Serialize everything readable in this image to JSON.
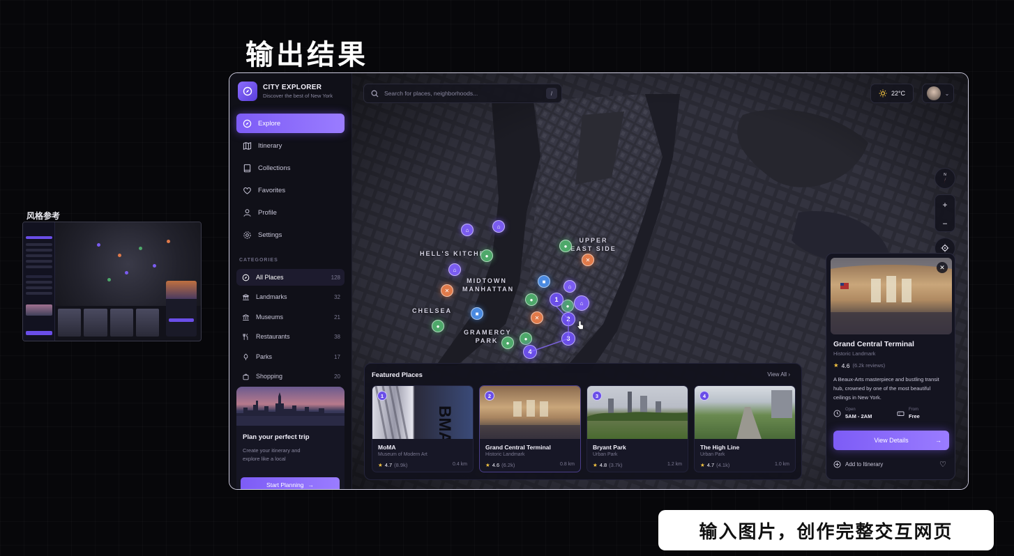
{
  "headline": "输出结果",
  "reference_label": "风格参考",
  "subtitle": "输入图片，创作完整交互网页",
  "brand": {
    "title": "CITY EXPLORER",
    "subtitle": "Discover the best of New York"
  },
  "nav": [
    {
      "label": "Explore",
      "icon": "compass-icon",
      "active": true
    },
    {
      "label": "Itinerary",
      "icon": "map-icon"
    },
    {
      "label": "Collections",
      "icon": "book-icon"
    },
    {
      "label": "Favorites",
      "icon": "heart-icon"
    },
    {
      "label": "Profile",
      "icon": "user-icon"
    },
    {
      "label": "Settings",
      "icon": "gear-icon"
    }
  ],
  "categories": {
    "header": "CATEGORIES",
    "items": [
      {
        "label": "All Places",
        "count": "128",
        "icon": "compass-icon",
        "active": true
      },
      {
        "label": "Landmarks",
        "count": "32",
        "icon": "landmark-icon"
      },
      {
        "label": "Museums",
        "count": "21",
        "icon": "museum-icon"
      },
      {
        "label": "Restaurants",
        "count": "38",
        "icon": "utensils-icon"
      },
      {
        "label": "Parks",
        "count": "17",
        "icon": "tree-icon"
      },
      {
        "label": "Shopping",
        "count": "20",
        "icon": "bag-icon"
      }
    ]
  },
  "promo": {
    "title": "Plan your perfect trip",
    "text": "Create your itinerary and explore like a local",
    "button": "Start Planning"
  },
  "search": {
    "placeholder": "Search for places, neighborhoods...",
    "shortcut": "/"
  },
  "weather": {
    "temp": "22°C",
    "icon": "sun-icon"
  },
  "map_controls": {
    "compass": "N",
    "zoom_in": "+",
    "zoom_out": "−"
  },
  "map_labels": [
    {
      "text": "HELL'S KITCHEN"
    },
    {
      "text": "MIDTOWN MANHATTAN"
    },
    {
      "text": "CHELSEA"
    },
    {
      "text": "GRAMERCY PARK"
    },
    {
      "text": "UPPER EAST SIDE"
    }
  ],
  "featured": {
    "title": "Featured Places",
    "view_all": "View All",
    "cards": [
      {
        "num": "1",
        "name": "MoMA",
        "type": "Museum of Modern Art",
        "rating": "4.7",
        "reviews": "(8.9k)",
        "distance": "0.4 km"
      },
      {
        "num": "2",
        "name": "Grand Central Terminal",
        "type": "Historic Landmark",
        "rating": "4.6",
        "reviews": "(6.2k)",
        "distance": "0.8 km"
      },
      {
        "num": "3",
        "name": "Bryant Park",
        "type": "Urban Park",
        "rating": "4.8",
        "reviews": "(3.7k)",
        "distance": "1.2 km"
      },
      {
        "num": "4",
        "name": "The High Line",
        "type": "Urban Park",
        "rating": "4.7",
        "reviews": "(4.1k)",
        "distance": "1.0 km"
      }
    ]
  },
  "detail": {
    "title": "Grand Central Terminal",
    "subtitle": "Historic Landmark",
    "rating": "4.6",
    "reviews": "(6.2k reviews)",
    "description": "A Beaux-Arts masterpiece and bustling transit hub, crowned by one of the most beautiful ceilings in New York.",
    "open_label": "Open",
    "open_value": "5AM - 2AM",
    "from_label": "From",
    "from_value": "Free",
    "button": "View Details",
    "add_label": "Add to Itinerary"
  },
  "colors": {
    "accent": "#7d5cf6",
    "food": "#e07a4a",
    "park": "#4ea86a",
    "shop": "#4a8ae0"
  }
}
